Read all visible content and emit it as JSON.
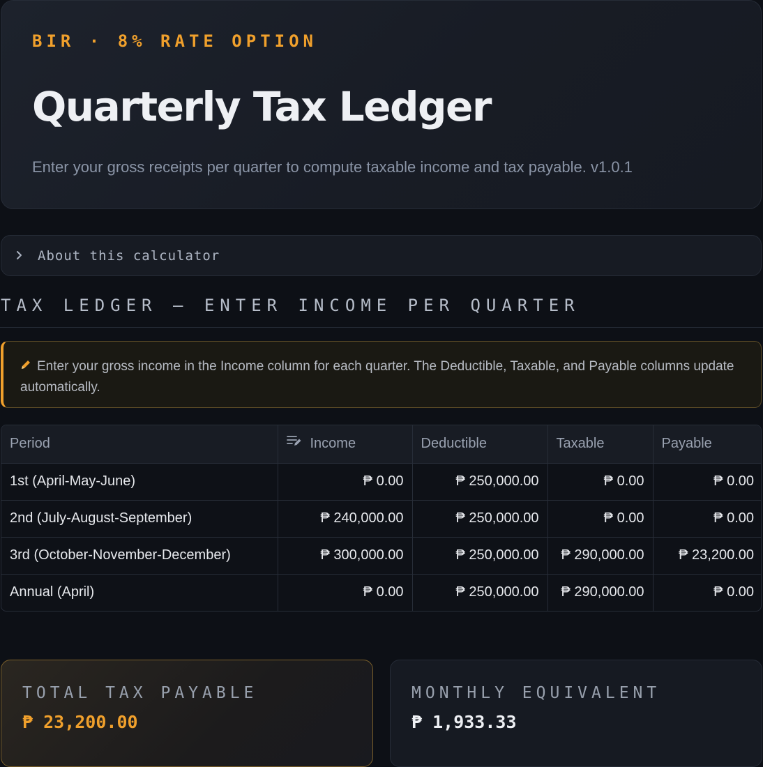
{
  "hero": {
    "eyebrow": "BIR · 8% RATE OPTION",
    "title": "Quarterly Tax Ledger",
    "subtitle": "Enter your gross receipts per quarter to compute taxable income and tax payable. v1.0.1"
  },
  "expander": {
    "label": "About this calculator",
    "icon": "chevron-right-icon"
  },
  "section": {
    "title": "TAX LEDGER — ENTER INCOME PER QUARTER"
  },
  "note": {
    "icon": "pencil-icon",
    "text": "Enter your gross income in the Income column for each quarter. The Deductible, Taxable, and Payable columns update automatically."
  },
  "table": {
    "columns": [
      "Period",
      "Income",
      "Deductible",
      "Taxable",
      "Payable"
    ],
    "editable_column_icon": "edit-list-icon",
    "rows": [
      [
        "1st (April-May-June)",
        "₱ 0.00",
        "₱ 250,000.00",
        "₱ 0.00",
        "₱ 0.00"
      ],
      [
        "2nd (July-August-September)",
        "₱ 240,000.00",
        "₱ 250,000.00",
        "₱ 0.00",
        "₱ 0.00"
      ],
      [
        "3rd (October-November-December)",
        "₱ 300,000.00",
        "₱ 250,000.00",
        "₱ 290,000.00",
        "₱ 23,200.00"
      ],
      [
        "Annual (April)",
        "₱ 0.00",
        "₱ 250,000.00",
        "₱ 290,000.00",
        "₱ 0.00"
      ]
    ]
  },
  "metrics": {
    "total": {
      "label": "TOTAL TAX PAYABLE",
      "value": "₱ 23,200.00"
    },
    "monthly": {
      "label": "MONTHLY EQUIVALENT",
      "value": "₱ 1,933.33"
    }
  },
  "colors": {
    "accent": "#f0a02c",
    "background": "#0d1016",
    "panel": "#181c24",
    "border": "#262c37"
  }
}
